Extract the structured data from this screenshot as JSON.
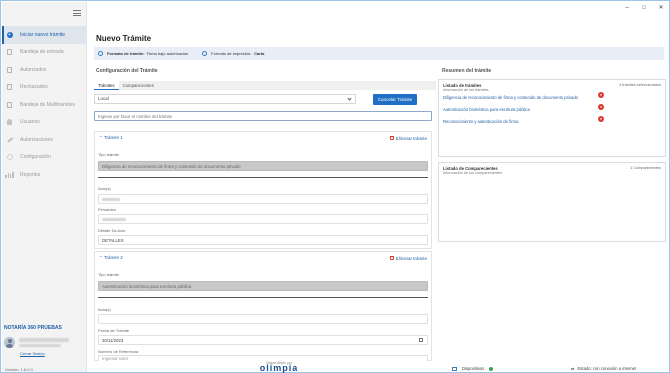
{
  "window": {
    "minimize": "–",
    "maximize": "□",
    "close": "✕"
  },
  "sidebar": {
    "items": [
      {
        "label": "Iniciar nuevo trámite",
        "icon": "plus-circle-icon",
        "active": true
      },
      {
        "label": "Bandeja de entrada",
        "icon": "inbox-icon"
      },
      {
        "label": "Autorizados",
        "icon": "document-icon"
      },
      {
        "label": "Rechazados",
        "icon": "document-x-icon"
      },
      {
        "label": "Bandeja de Multitramites",
        "icon": "stack-icon"
      },
      {
        "label": "Usuarios",
        "icon": "user-icon"
      },
      {
        "label": "Autorizaciones",
        "icon": "wrench-icon"
      },
      {
        "label": "Configuración",
        "icon": "gear-icon"
      },
      {
        "label": "Reportes",
        "icon": "bar-chart-icon"
      }
    ],
    "org": "NOTARÍA 360 PRUEBAS",
    "logout": "Cerrar Sesión",
    "version": "Versión: 1.6.0.0"
  },
  "main": {
    "title": "Nuevo Trámite",
    "format_label": "Formato de trámite:",
    "format_value": "Firma bajo autorización",
    "print_label": "Formato de impresión:",
    "print_value": "Carta",
    "config_title": "Configuración del Trámite",
    "tabs": [
      "Trámites",
      "Comparecientes"
    ],
    "select_value": "Local",
    "cancel_button": "Cancelar Trámite",
    "search_placeholder": "Ingrese por favor el nombre del trámite",
    "tramites": [
      {
        "title": "Trámite 1",
        "delete": "Eliminar trámite",
        "type_label": "Tipo trámite",
        "type_value": "Diligencia de reconocimiento de firma y contenido de documento privado",
        "acto_label": "Acto(s)",
        "firmantes_label": "Firmantes",
        "detalle_label": "Detalle Ds Acto",
        "detalle_value": "DETALLES"
      },
      {
        "title": "Trámite 2",
        "delete": "Eliminar trámite",
        "type_label": "Tipo trámite",
        "type_value": "Autenticación biométrica para escritura pública",
        "acto_label": "Acto(s)",
        "fecha_label": "Fecha de Trámite",
        "fecha_value": "30/11/2023",
        "ref_label": "Numero de Referencia",
        "ref_value": "Ingresar valor"
      }
    ]
  },
  "resumen": {
    "title": "Resumen del trámite",
    "tramites_title": "Listado de trámites",
    "tramites_sub": "Información de los trámites",
    "tramites_count": "3 trámites seleccionados",
    "items": [
      "Diligencia de reconocimiento de firma y contenido de documento privado",
      "Autenticación biométrica para escritura pública",
      "Reconocimiento y autenticación de firma"
    ],
    "comp_title": "Listado de Comparecientes",
    "comp_sub": "Información de los comparecientes",
    "comp_count": "1 Comparecientes"
  },
  "status": {
    "dev_by": "Desarrollado por",
    "brand": "olimpia",
    "devices": "Dispositivos",
    "network": "Estado: con conexión a internet"
  }
}
